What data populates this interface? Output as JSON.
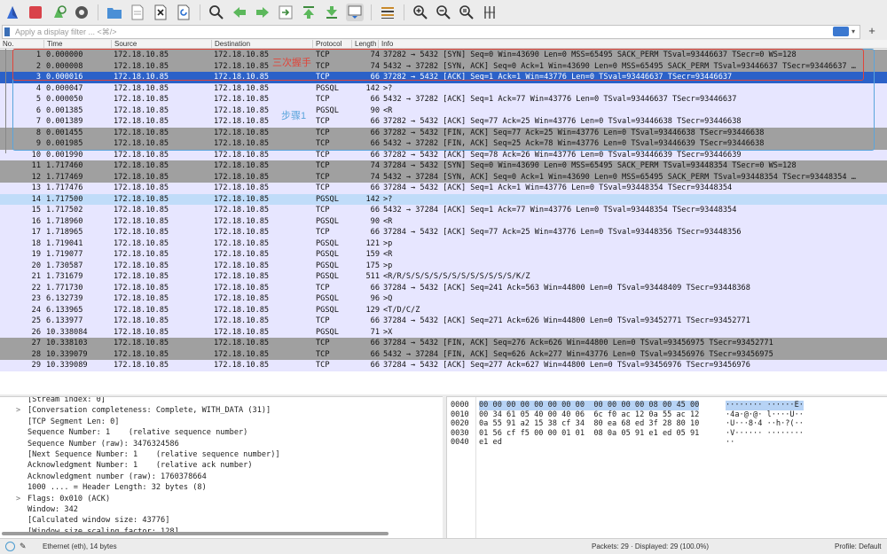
{
  "filter": {
    "placeholder": "Apply a display filter ... <⌘/>"
  },
  "columns": [
    "No.",
    "Time",
    "Source",
    "Destination",
    "Protocol",
    "Length",
    "Info"
  ],
  "packets": [
    {
      "no": "1",
      "time": "0.000000",
      "src": "172.18.10.85",
      "dst": "172.18.10.85",
      "proto": "TCP",
      "len": "74",
      "info": "37282 → 5432 [SYN] Seq=0 Win=43690 Len=0 MSS=65495 SACK_PERM TSval=93446637 TSecr=0 WS=128",
      "style": "dark"
    },
    {
      "no": "2",
      "time": "0.000008",
      "src": "172.18.10.85",
      "dst": "172.18.10.85",
      "proto": "TCP",
      "len": "74",
      "info": "5432 → 37282 [SYN, ACK] Seq=0 Ack=1 Win=43690 Len=0 MSS=65495 SACK_PERM TSval=93446637 TSecr=93446637 …",
      "style": "dark"
    },
    {
      "no": "3",
      "time": "0.000016",
      "src": "172.18.10.85",
      "dst": "172.18.10.85",
      "proto": "TCP",
      "len": "66",
      "info": "37282 → 5432 [ACK] Seq=1 Ack=1 Win=43776 Len=0 TSval=93446637 TSecr=93446637",
      "style": "sel"
    },
    {
      "no": "4",
      "time": "0.000047",
      "src": "172.18.10.85",
      "dst": "172.18.10.85",
      "proto": "PGSQL",
      "len": "142",
      "info": ">?",
      "style": "tcp"
    },
    {
      "no": "5",
      "time": "0.000050",
      "src": "172.18.10.85",
      "dst": "172.18.10.85",
      "proto": "TCP",
      "len": "66",
      "info": "5432 → 37282 [ACK] Seq=1 Ack=77 Win=43776 Len=0 TSval=93446637 TSecr=93446637",
      "style": "tcp"
    },
    {
      "no": "6",
      "time": "0.001385",
      "src": "172.18.10.85",
      "dst": "172.18.10.85",
      "proto": "PGSQL",
      "len": "90",
      "info": "<R",
      "style": "tcp"
    },
    {
      "no": "7",
      "time": "0.001389",
      "src": "172.18.10.85",
      "dst": "172.18.10.85",
      "proto": "TCP",
      "len": "66",
      "info": "37282 → 5432 [ACK] Seq=77 Ack=25 Win=43776 Len=0 TSval=93446638 TSecr=93446638",
      "style": "tcp"
    },
    {
      "no": "8",
      "time": "0.001455",
      "src": "172.18.10.85",
      "dst": "172.18.10.85",
      "proto": "TCP",
      "len": "66",
      "info": "37282 → 5432 [FIN, ACK] Seq=77 Ack=25 Win=43776 Len=0 TSval=93446638 TSecr=93446638",
      "style": "dark"
    },
    {
      "no": "9",
      "time": "0.001985",
      "src": "172.18.10.85",
      "dst": "172.18.10.85",
      "proto": "TCP",
      "len": "66",
      "info": "5432 → 37282 [FIN, ACK] Seq=25 Ack=78 Win=43776 Len=0 TSval=93446639 TSecr=93446638",
      "style": "dark"
    },
    {
      "no": "10",
      "time": "0.001990",
      "src": "172.18.10.85",
      "dst": "172.18.10.85",
      "proto": "TCP",
      "len": "66",
      "info": "37282 → 5432 [ACK] Seq=78 Ack=26 Win=43776 Len=0 TSval=93446639 TSecr=93446639",
      "style": "tcp"
    },
    {
      "no": "11",
      "time": "1.717460",
      "src": "172.18.10.85",
      "dst": "172.18.10.85",
      "proto": "TCP",
      "len": "74",
      "info": "37284 → 5432 [SYN] Seq=0 Win=43690 Len=0 MSS=65495 SACK_PERM TSval=93448354 TSecr=0 WS=128",
      "style": "dark"
    },
    {
      "no": "12",
      "time": "1.717469",
      "src": "172.18.10.85",
      "dst": "172.18.10.85",
      "proto": "TCP",
      "len": "74",
      "info": "5432 → 37284 [SYN, ACK] Seq=0 Ack=1 Win=43690 Len=0 MSS=65495 SACK_PERM TSval=93448354 TSecr=93448354 …",
      "style": "dark"
    },
    {
      "no": "13",
      "time": "1.717476",
      "src": "172.18.10.85",
      "dst": "172.18.10.85",
      "proto": "TCP",
      "len": "66",
      "info": "37284 → 5432 [ACK] Seq=1 Ack=1 Win=43776 Len=0 TSval=93448354 TSecr=93448354",
      "style": "tcp"
    },
    {
      "no": "14",
      "time": "1.717500",
      "src": "172.18.10.85",
      "dst": "172.18.10.85",
      "proto": "PGSQL",
      "len": "142",
      "info": ">?",
      "style": "lt"
    },
    {
      "no": "15",
      "time": "1.717502",
      "src": "172.18.10.85",
      "dst": "172.18.10.85",
      "proto": "TCP",
      "len": "66",
      "info": "5432 → 37284 [ACK] Seq=1 Ack=77 Win=43776 Len=0 TSval=93448354 TSecr=93448354",
      "style": "tcp"
    },
    {
      "no": "16",
      "time": "1.718960",
      "src": "172.18.10.85",
      "dst": "172.18.10.85",
      "proto": "PGSQL",
      "len": "90",
      "info": "<R",
      "style": "tcp"
    },
    {
      "no": "17",
      "time": "1.718965",
      "src": "172.18.10.85",
      "dst": "172.18.10.85",
      "proto": "TCP",
      "len": "66",
      "info": "37284 → 5432 [ACK] Seq=77 Ack=25 Win=43776 Len=0 TSval=93448356 TSecr=93448356",
      "style": "tcp"
    },
    {
      "no": "18",
      "time": "1.719041",
      "src": "172.18.10.85",
      "dst": "172.18.10.85",
      "proto": "PGSQL",
      "len": "121",
      "info": ">p",
      "style": "tcp"
    },
    {
      "no": "19",
      "time": "1.719077",
      "src": "172.18.10.85",
      "dst": "172.18.10.85",
      "proto": "PGSQL",
      "len": "159",
      "info": "<R",
      "style": "tcp"
    },
    {
      "no": "20",
      "time": "1.730587",
      "src": "172.18.10.85",
      "dst": "172.18.10.85",
      "proto": "PGSQL",
      "len": "175",
      "info": ">p",
      "style": "tcp"
    },
    {
      "no": "21",
      "time": "1.731679",
      "src": "172.18.10.85",
      "dst": "172.18.10.85",
      "proto": "PGSQL",
      "len": "511",
      "info": "<R/R/S/S/S/S/S/S/S/S/S/S/S/S/K/Z",
      "style": "tcp"
    },
    {
      "no": "22",
      "time": "1.771730",
      "src": "172.18.10.85",
      "dst": "172.18.10.85",
      "proto": "TCP",
      "len": "66",
      "info": "37284 → 5432 [ACK] Seq=241 Ack=563 Win=44800 Len=0 TSval=93448409 TSecr=93448368",
      "style": "tcp"
    },
    {
      "no": "23",
      "time": "6.132739",
      "src": "172.18.10.85",
      "dst": "172.18.10.85",
      "proto": "PGSQL",
      "len": "96",
      "info": ">Q",
      "style": "tcp"
    },
    {
      "no": "24",
      "time": "6.133965",
      "src": "172.18.10.85",
      "dst": "172.18.10.85",
      "proto": "PGSQL",
      "len": "129",
      "info": "<T/D/C/Z",
      "style": "tcp"
    },
    {
      "no": "25",
      "time": "6.133977",
      "src": "172.18.10.85",
      "dst": "172.18.10.85",
      "proto": "TCP",
      "len": "66",
      "info": "37284 → 5432 [ACK] Seq=271 Ack=626 Win=44800 Len=0 TSval=93452771 TSecr=93452771",
      "style": "tcp"
    },
    {
      "no": "26",
      "time": "10.338084",
      "src": "172.18.10.85",
      "dst": "172.18.10.85",
      "proto": "PGSQL",
      "len": "71",
      "info": ">X",
      "style": "tcp"
    },
    {
      "no": "27",
      "time": "10.338103",
      "src": "172.18.10.85",
      "dst": "172.18.10.85",
      "proto": "TCP",
      "len": "66",
      "info": "37284 → 5432 [FIN, ACK] Seq=276 Ack=626 Win=44800 Len=0 TSval=93456975 TSecr=93452771",
      "style": "dark"
    },
    {
      "no": "28",
      "time": "10.339079",
      "src": "172.18.10.85",
      "dst": "172.18.10.85",
      "proto": "TCP",
      "len": "66",
      "info": "5432 → 37284 [FIN, ACK] Seq=626 Ack=277 Win=43776 Len=0 TSval=93456976 TSecr=93456975",
      "style": "dark"
    },
    {
      "no": "29",
      "time": "10.339089",
      "src": "172.18.10.85",
      "dst": "172.18.10.85",
      "proto": "TCP",
      "len": "66",
      "info": "37284 → 5432 [ACK] Seq=277 Ack=627 Win=44800 Len=0 TSval=93456976 TSecr=93456976",
      "style": "tcp"
    }
  ],
  "annotations": {
    "handshake": "三次握手",
    "step1": "步骤1"
  },
  "detail": [
    {
      "arrow": "",
      "text": "[Stream index: 0]"
    },
    {
      "arrow": ">",
      "text": "[Conversation completeness: Complete, WITH_DATA (31)]"
    },
    {
      "arrow": "",
      "text": "[TCP Segment Len: 0]"
    },
    {
      "arrow": "",
      "text": "Sequence Number: 1    (relative sequence number)"
    },
    {
      "arrow": "",
      "text": "Sequence Number (raw): 3476324586"
    },
    {
      "arrow": "",
      "text": "[Next Sequence Number: 1    (relative sequence number)]"
    },
    {
      "arrow": "",
      "text": "Acknowledgment Number: 1    (relative ack number)"
    },
    {
      "arrow": "",
      "text": "Acknowledgment number (raw): 1760378664"
    },
    {
      "arrow": "",
      "text": "1000 .... = Header Length: 32 bytes (8)"
    },
    {
      "arrow": ">",
      "text": "Flags: 0x010 (ACK)"
    },
    {
      "arrow": "",
      "text": "Window: 342"
    },
    {
      "arrow": "",
      "text": "[Calculated window size: 43776]"
    },
    {
      "arrow": "",
      "text": "[Window size scaling factor: 128]"
    }
  ],
  "hex": [
    {
      "off": "0000",
      "bytes": "00 00 00 00 00 00 00 00  00 00 00 00 08 00 45 00",
      "ascii": "········ ······E·"
    },
    {
      "off": "0010",
      "bytes": "00 34 61 05 40 00 40 06  6c f0 ac 12 0a 55 ac 12",
      "ascii": "·4a·@·@· l····U··"
    },
    {
      "off": "0020",
      "bytes": "0a 55 91 a2 15 38 cf 34  80 ea 68 ed 3f 28 80 10",
      "ascii": "·U···8·4 ··h·?(··"
    },
    {
      "off": "0030",
      "bytes": "01 56 cf f5 00 00 01 01  08 0a 05 91 e1 ed 05 91",
      "ascii": "·V······ ········"
    },
    {
      "off": "0040",
      "bytes": "e1 ed",
      "ascii": "··"
    }
  ],
  "status": {
    "interface": "Ethernet (eth), 14 bytes",
    "packets": "Packets: 29 · Displayed: 29 (100.0%)",
    "profile": "Profile: Default"
  }
}
